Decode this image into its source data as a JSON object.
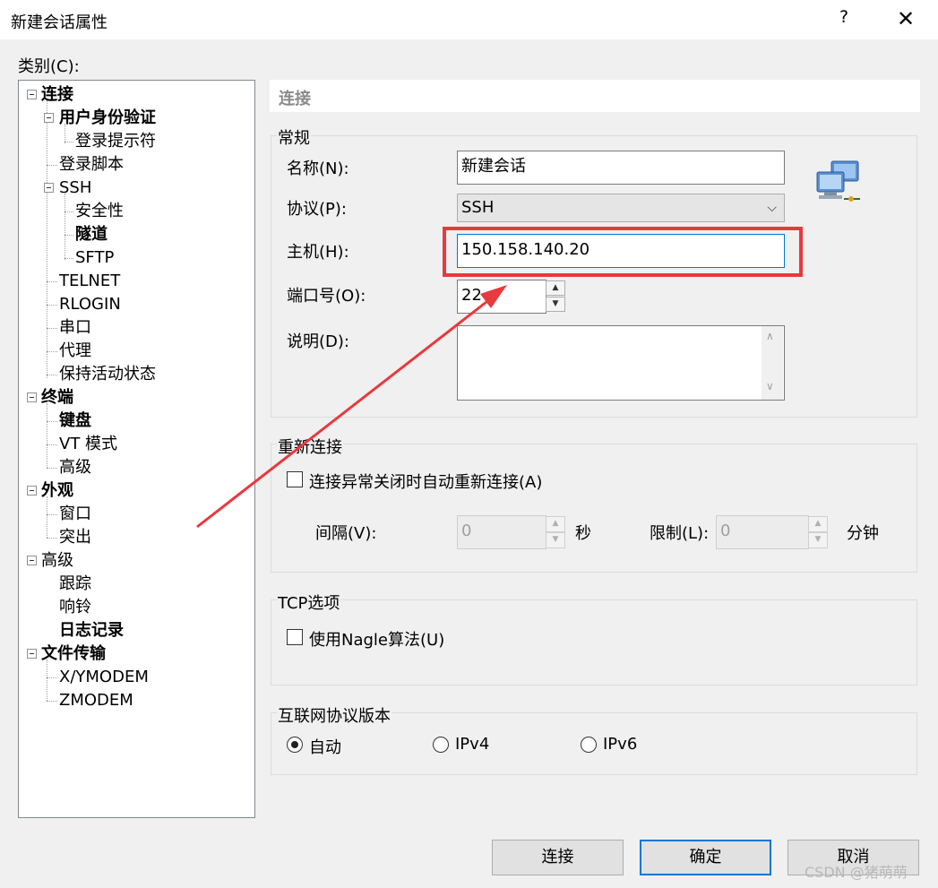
{
  "window": {
    "title": "新建会话属性",
    "help_label": "?",
    "close_label": "✕"
  },
  "category_label": "类别(C):",
  "tree": [
    {
      "label": "连接",
      "bold": true
    },
    {
      "label": "用户身份验证",
      "bold": true
    },
    {
      "label": "登录提示符",
      "bold": false
    },
    {
      "label": "登录脚本",
      "bold": false
    },
    {
      "label": "SSH",
      "bold": false
    },
    {
      "label": "安全性",
      "bold": false
    },
    {
      "label": "隧道",
      "bold": true
    },
    {
      "label": "SFTP",
      "bold": false
    },
    {
      "label": "TELNET",
      "bold": false
    },
    {
      "label": "RLOGIN",
      "bold": false
    },
    {
      "label": "串口",
      "bold": false
    },
    {
      "label": "代理",
      "bold": false
    },
    {
      "label": "保持活动状态",
      "bold": false
    },
    {
      "label": "终端",
      "bold": true
    },
    {
      "label": "键盘",
      "bold": true
    },
    {
      "label": "VT 模式",
      "bold": false
    },
    {
      "label": "高级",
      "bold": false
    },
    {
      "label": "外观",
      "bold": true
    },
    {
      "label": "窗口",
      "bold": false
    },
    {
      "label": "突出",
      "bold": false
    },
    {
      "label": "高级",
      "bold": false
    },
    {
      "label": "跟踪",
      "bold": false
    },
    {
      "label": "响铃",
      "bold": false
    },
    {
      "label": "日志记录",
      "bold": true
    },
    {
      "label": "文件传输",
      "bold": true
    },
    {
      "label": "X/YMODEM",
      "bold": false
    },
    {
      "label": "ZMODEM",
      "bold": false
    }
  ],
  "panel_title": "连接",
  "general": {
    "title": "常规",
    "name_label": "名称(N):",
    "name_value": "新建会话",
    "protocol_label": "协议(P):",
    "protocol_value": "SSH",
    "host_label": "主机(H):",
    "host_value": "150.158.140.20",
    "port_label": "端口号(O):",
    "port_value": "22",
    "desc_label": "说明(D):",
    "desc_value": ""
  },
  "reconnect": {
    "title": "重新连接",
    "auto_label": "连接异常关闭时自动重新连接(A)",
    "auto_checked": false,
    "interval_label": "间隔(V):",
    "interval_value": "0",
    "interval_unit": "秒",
    "limit_label": "限制(L):",
    "limit_value": "0",
    "limit_unit": "分钟"
  },
  "tcp": {
    "title": "TCP选项",
    "nagle_label": "使用Nagle算法(U)",
    "nagle_checked": false
  },
  "ip_version": {
    "title": "互联网协议版本",
    "options": [
      "自动",
      "IPv4",
      "IPv6"
    ],
    "selected": "自动"
  },
  "buttons": {
    "connect": "连接",
    "ok": "确定",
    "cancel": "取消"
  },
  "watermark": "CSDN @猪萌萌",
  "annotation_color": "#e8393d",
  "accent_color": "#0078d7"
}
